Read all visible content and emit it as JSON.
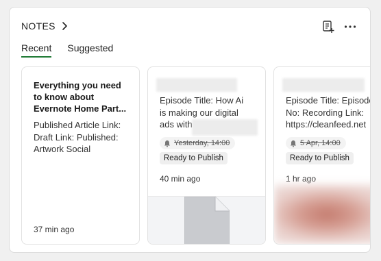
{
  "header": {
    "title": "NOTES"
  },
  "tabs": [
    {
      "label": "Recent",
      "active": true
    },
    {
      "label": "Suggested",
      "active": false
    }
  ],
  "cards": [
    {
      "title_lines": [
        "Everything you need",
        "to know about",
        "Evernote Home Part..."
      ],
      "body_lines": [
        "Published Article Link:",
        "Draft Link: Published:",
        "Artwork Social"
      ],
      "time": "37 min ago"
    },
    {
      "snippet_lines": [
        "Episode Title: How Ai",
        "is making our digital",
        "ads with"
      ],
      "reminder": "Yesterday, 14:00",
      "status": "Ready to Publish",
      "time": "40 min ago"
    },
    {
      "snippet_lines": [
        "Episode Title: Episode",
        "No: Recording Link:",
        "https://cleanfeed.net"
      ],
      "reminder": "5 Apr, 14:00",
      "status": "Ready to Publish",
      "time": "1 hr ago"
    }
  ],
  "colors": {
    "accent": "#1f7a34",
    "background": "#f0f0f0",
    "card": "#ffffff"
  }
}
